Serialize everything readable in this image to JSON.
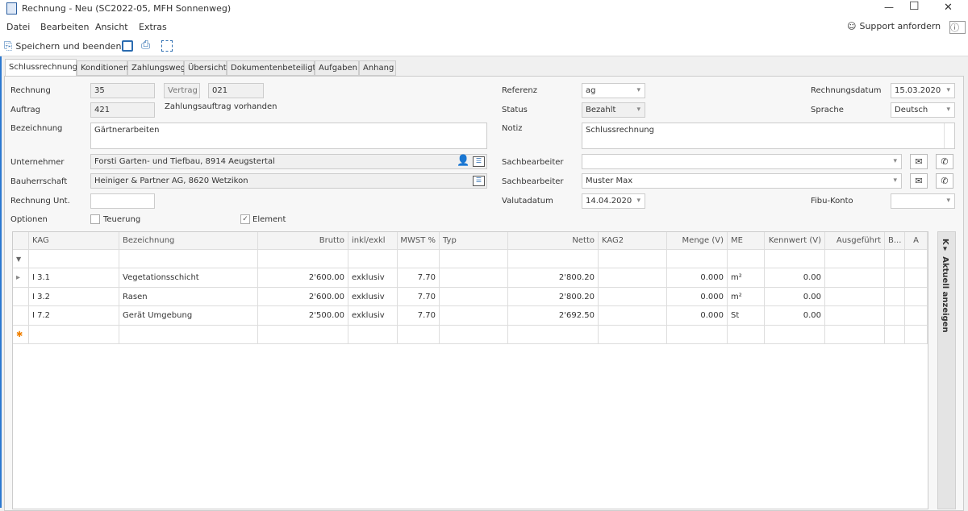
{
  "window": {
    "title": "Rechnung - Neu (SC2022-05, MFH Sonnenweg)",
    "minimize": "—",
    "maximize": "☐",
    "close": "✕"
  },
  "menu": [
    "Datei",
    "Bearbeiten",
    "Ansicht",
    "Extras"
  ],
  "support": "Support anfordern",
  "toolbar": {
    "save_close": "Speichern und beenden"
  },
  "tabs": [
    "Schlussrechnung",
    "Konditionen",
    "Zahlungsweg",
    "Übersicht",
    "Dokumentenbeteiligte",
    "Aufgaben",
    "Anhang"
  ],
  "form": {
    "rechnung_label": "Rechnung",
    "rechnung": "35",
    "vertrag_label": "Vertrag",
    "vertrag": "021",
    "auftrag_label": "Auftrag",
    "auftrag": "421",
    "zahlungsauftrag": "Zahlungsauftrag vorhanden",
    "bezeichnung_label": "Bezeichnung",
    "bezeichnung": "Gärtnerarbeiten",
    "unternehmer_label": "Unternehmer",
    "unternehmer": "Forsti Garten- und Tiefbau, 8914 Aeugstertal",
    "bauherrschaft_label": "Bauherrschaft",
    "bauherrschaft": "Heiniger & Partner AG, 8620 Wetzikon",
    "rechnung_unt_label": "Rechnung Unt.",
    "rechnung_unt": "",
    "optionen_label": "Optionen",
    "teuerung": "Teuerung",
    "teuerung_checked": false,
    "element": "Element",
    "element_checked": true,
    "referenz_label": "Referenz",
    "referenz": "ag",
    "status_label": "Status",
    "status": "Bezahlt",
    "notiz_label": "Notiz",
    "notiz": "Schlussrechnung",
    "sachbearbeiter_label": "Sachbearbeiter",
    "sachbearbeiter1": "",
    "sachbearbeiter2": "Muster Max",
    "valutadatum_label": "Valutadatum",
    "valutadatum": "14.04.2020",
    "rechnungsdatum_label": "Rechnungsdatum",
    "rechnungsdatum": "15.03.2020",
    "sprache_label": "Sprache",
    "sprache": "Deutsch",
    "fibu_label": "Fibu-Konto",
    "fibu": ""
  },
  "grid": {
    "columns": [
      "KAG",
      "Bezeichnung",
      "Brutto",
      "inkl/exkl",
      "MWST %",
      "Typ",
      "Netto",
      "KAG2",
      "Menge (V)",
      "ME",
      "Kennwert (V)",
      "Ausgeführt",
      "B...",
      "A"
    ],
    "rows": [
      [
        "I 3.1",
        "Vegetationsschicht",
        "2'600.00",
        "exklusiv",
        "7.70",
        "",
        "2'800.20",
        "",
        "0.000",
        "m²",
        "0.00",
        "",
        "",
        ""
      ],
      [
        "I 3.2",
        "Rasen",
        "2'600.00",
        "exklusiv",
        "7.70",
        "",
        "2'800.20",
        "",
        "0.000",
        "m²",
        "0.00",
        "",
        "",
        ""
      ],
      [
        "I 7.2",
        "Gerät Umgebung",
        "2'500.00",
        "exklusiv",
        "7.70",
        "",
        "2'692.50",
        "",
        "0.000",
        "St",
        "0.00",
        "",
        "",
        ""
      ]
    ]
  },
  "side_panel": "K▾ Aktuell anzeigen"
}
